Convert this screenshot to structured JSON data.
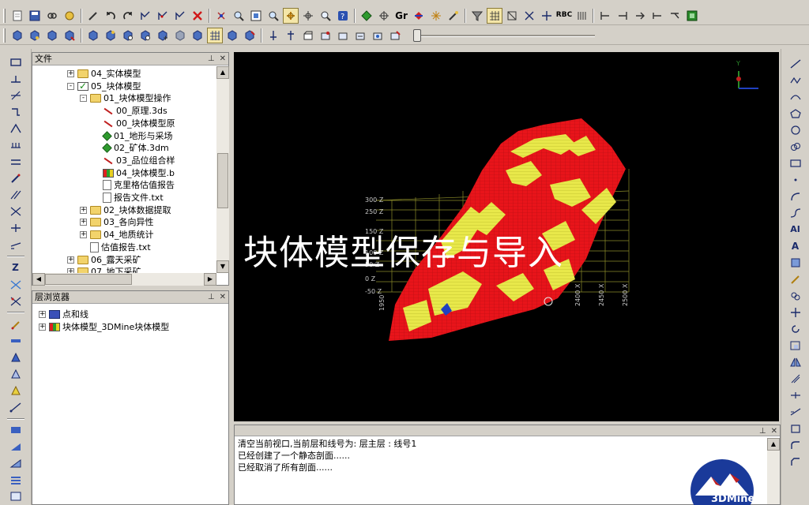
{
  "toolbar_main": {
    "icons": [
      "new-icon",
      "save-icon",
      "link-icon",
      "layers-icon",
      "pen-icon",
      "undo-icon",
      "redo-icon",
      "node-icon",
      "edit-node-icon",
      "node-delete-icon",
      "delete-icon",
      "magnet-icon",
      "zoom-window-icon",
      "zoom-extents-icon",
      "pan-icon",
      "grid-snap-icon",
      "intersect-icon",
      "zoom-icon",
      "help-icon",
      "diamond-icon",
      "crosshair-icon",
      "gr-icon",
      "arrow-icon",
      "sparkle-icon",
      "wand-icon",
      "funnel-icon",
      "grid-icon",
      "box-icon",
      "x-icon",
      "cross-icon",
      "text-icon",
      "bars-icon",
      "arrow-left-icon",
      "arrow-right-icon",
      "branch-icon",
      "green-box-icon"
    ],
    "gr_label": "Gr",
    "abc_label": "RBC"
  },
  "toolbar_second": {
    "icons": [
      "cube-1-icon",
      "cube-2-icon",
      "cube-3-icon",
      "cube-4-icon",
      "cube-5-icon",
      "cube-6-icon",
      "cube-7-icon",
      "cube-8-icon",
      "cube-9-icon",
      "cube-10-icon",
      "cube-11-icon",
      "cube-12-icon",
      "layer-up-icon",
      "layer-down-icon",
      "layer-copy-icon",
      "layer-a-icon",
      "layer-b-icon",
      "layer-c-icon",
      "layer-d-icon",
      "layer-e-icon"
    ],
    "slider_value": 0
  },
  "file_panel": {
    "title": "文件",
    "items": [
      {
        "label": "04_实体模型",
        "indent": 0,
        "expander": "+",
        "icon": "folder"
      },
      {
        "label": "05_块体模型",
        "indent": 0,
        "expander": "-",
        "icon": "check"
      },
      {
        "label": "01_块体模型操作",
        "indent": 1,
        "expander": "-",
        "icon": "folder"
      },
      {
        "label": "00_原理.3ds",
        "indent": 2,
        "expander": "",
        "icon": "line"
      },
      {
        "label": "00_块体模型原",
        "indent": 2,
        "expander": "",
        "icon": "line"
      },
      {
        "label": "01_地形与采场",
        "indent": 2,
        "expander": "",
        "icon": "diamond"
      },
      {
        "label": "02_矿体.3dm",
        "indent": 2,
        "expander": "",
        "icon": "diamond"
      },
      {
        "label": "03_品位组合样",
        "indent": 2,
        "expander": "",
        "icon": "line"
      },
      {
        "label": "04_块体模型.b",
        "indent": 2,
        "expander": "",
        "icon": "block"
      },
      {
        "label": "克里格估值报告",
        "indent": 2,
        "expander": "",
        "icon": "file"
      },
      {
        "label": "报告文件.txt",
        "indent": 2,
        "expander": "",
        "icon": "file"
      },
      {
        "label": "02_块体数据提取",
        "indent": 1,
        "expander": "+",
        "icon": "folder"
      },
      {
        "label": "03_各向异性",
        "indent": 1,
        "expander": "+",
        "icon": "folder"
      },
      {
        "label": "04_地质统计",
        "indent": 1,
        "expander": "+",
        "icon": "folder"
      },
      {
        "label": "估值报告.txt",
        "indent": 1,
        "expander": "",
        "icon": "file"
      },
      {
        "label": "06_露天采矿",
        "indent": 0,
        "expander": "+",
        "icon": "folder"
      },
      {
        "label": "07_地下采矿",
        "indent": 0,
        "expander": "+",
        "icon": "folder"
      }
    ]
  },
  "layer_panel": {
    "title": "层浏览器",
    "items": [
      {
        "label": "点和线",
        "icon": "layer-points"
      },
      {
        "label": "块体模型_3DMine块体模型",
        "icon": "layer-block"
      }
    ]
  },
  "viewport": {
    "overlay_title": "块体模型保存与导入",
    "axis_label_z": "Y",
    "grid_labels_y": [
      "300 Z",
      "250 Z",
      "150 Z",
      "100 Z",
      "50 Z",
      "0 Z",
      "-50 Z"
    ],
    "grid_labels_x": [
      "1950",
      "2400 X",
      "2450 X",
      "2500 X"
    ],
    "colors": {
      "ore_red": "#e8141a",
      "ore_yellow": "#e8e84a",
      "grid": "#8c8c2a"
    }
  },
  "output_panel": {
    "lines": [
      "清空当前视口,当前层和线号为: 层主层 : 线号1",
      "已经创建了一个静态剖面......",
      "已经取消了所有剖面......"
    ]
  },
  "brand": {
    "logo_text": "3DMine"
  }
}
